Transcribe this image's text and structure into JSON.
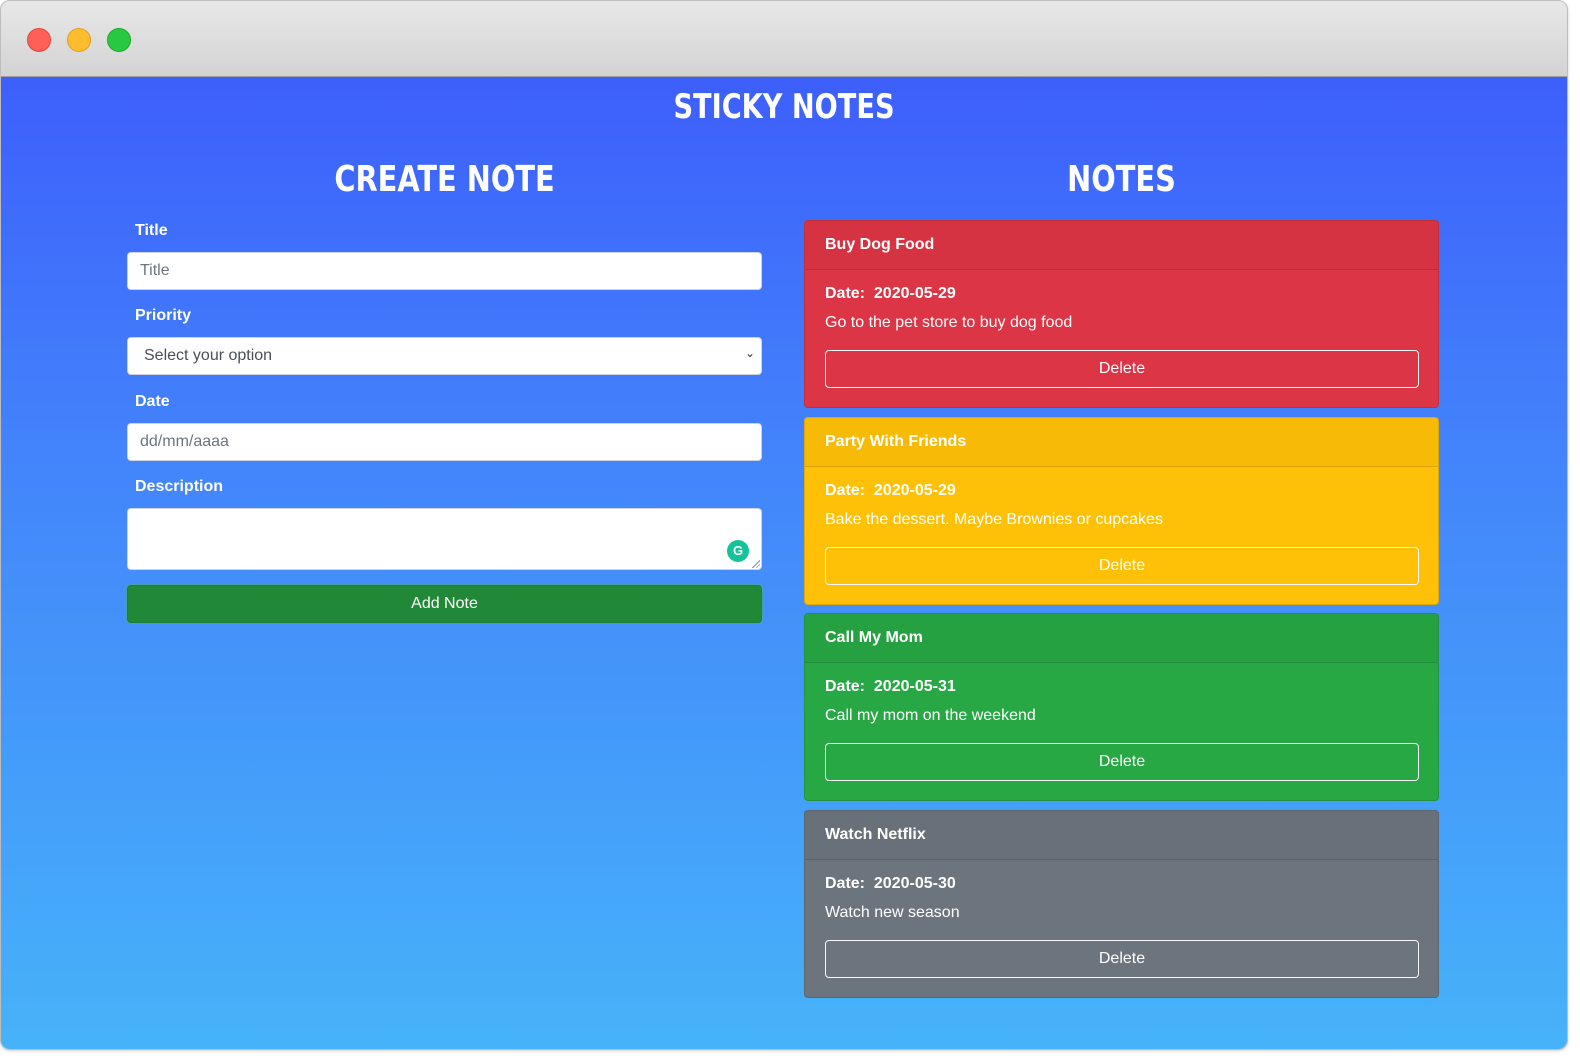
{
  "app": {
    "title": "Sticky Notes"
  },
  "create": {
    "heading": "Create Note",
    "title_label": "Title",
    "title_placeholder": "Title",
    "priority_label": "Priority",
    "priority_selected": "Select your option",
    "date_label": "Date",
    "date_placeholder": "dd/mm/aaaa",
    "description_label": "Description",
    "add_button": "Add Note"
  },
  "notes": {
    "heading": "Notes",
    "items": [
      {
        "title": "Buy Dog Food",
        "date_label": "Date:",
        "date": "2020-05-29",
        "description": "Go to the pet store to buy dog food",
        "delete_label": "Delete",
        "color": "#dc3545"
      },
      {
        "title": "Party With Friends",
        "date_label": "Date:",
        "date": "2020-05-29",
        "description": "Bake the dessert. Maybe Brownies or cupcakes",
        "delete_label": "Delete",
        "color": "#ffc107"
      },
      {
        "title": "Call My Mom",
        "date_label": "Date:",
        "date": "2020-05-31",
        "description": "Call my mom on the weekend",
        "delete_label": "Delete",
        "color": "#28a745"
      },
      {
        "title": "Watch Netflix",
        "date_label": "Date:",
        "date": "2020-05-30",
        "description": "Watch new season",
        "delete_label": "Delete",
        "color": "#6c757d"
      }
    ]
  },
  "icons": {
    "grammarly": "grammarly-icon",
    "chevron": "chevron-down-icon"
  }
}
